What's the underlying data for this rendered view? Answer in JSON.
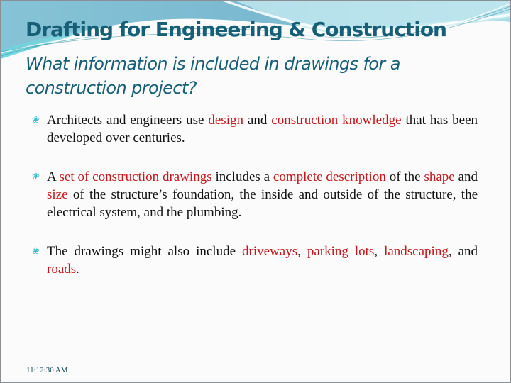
{
  "slide": {
    "title": "Drafting for Engineering & Construction",
    "subtitle": "What information is included in drawings for a construction project?",
    "bullet_icon": "curl-swirl-icon",
    "bullet_glyph": "❀",
    "bullets": [
      {
        "segments": [
          {
            "text": "Architects and engineers use ",
            "highlight": false
          },
          {
            "text": "design",
            "highlight": true
          },
          {
            "text": " and ",
            "highlight": false
          },
          {
            "text": "construction knowledge",
            "highlight": true
          },
          {
            "text": " that has been developed over centuries.",
            "highlight": false
          }
        ]
      },
      {
        "segments": [
          {
            "text": "A ",
            "highlight": false
          },
          {
            "text": "set of construction drawings",
            "highlight": true
          },
          {
            "text": " includes a ",
            "highlight": false
          },
          {
            "text": "complete description",
            "highlight": true
          },
          {
            "text": " of the ",
            "highlight": false
          },
          {
            "text": "shape",
            "highlight": true
          },
          {
            "text": " and ",
            "highlight": false
          },
          {
            "text": "size",
            "highlight": true
          },
          {
            "text": " of the structure’s foundation, the inside and outside of the structure, the electrical system, and the plumbing.",
            "highlight": false
          }
        ]
      },
      {
        "segments": [
          {
            "text": "The drawings might also include ",
            "highlight": false
          },
          {
            "text": "driveways",
            "highlight": true
          },
          {
            "text": ", ",
            "highlight": false
          },
          {
            "text": "parking lots",
            "highlight": true
          },
          {
            "text": ", ",
            "highlight": false
          },
          {
            "text": "landscaping",
            "highlight": true
          },
          {
            "text": ", and ",
            "highlight": false
          },
          {
            "text": "roads",
            "highlight": true
          },
          {
            "text": ".",
            "highlight": false
          }
        ]
      }
    ],
    "footer_time": "11:12:30 AM"
  },
  "colors": {
    "title": "#175e77",
    "highlight": "#c8151b",
    "body_text": "#111111",
    "bullet_icon": "#3bbac6",
    "wave_top": "#7fc1d6",
    "wave_light": "#bfe6ee"
  }
}
